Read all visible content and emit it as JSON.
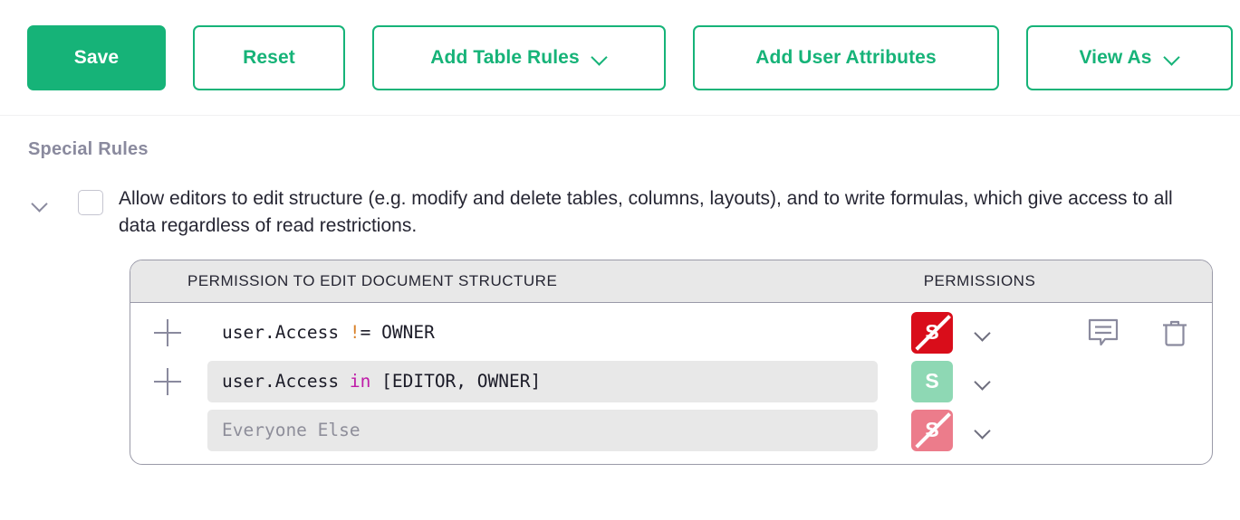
{
  "toolbar": {
    "buttons": [
      {
        "label": "Save",
        "style": "primary",
        "icon": null,
        "name": "save-button"
      },
      {
        "label": "Reset",
        "style": "outline",
        "icon": null,
        "name": "reset-button"
      },
      {
        "label": "Add Table Rules",
        "style": "outline",
        "icon": "chevron-down-icon",
        "name": "add-table-rules-button"
      },
      {
        "label": "Add User Attributes",
        "style": "outline",
        "icon": null,
        "name": "add-user-attributes-button"
      },
      {
        "label": "View As",
        "style": "outline",
        "icon": "chevron-down-icon",
        "name": "view-as-button"
      }
    ]
  },
  "section": {
    "title": "Special Rules"
  },
  "special_rule": {
    "collapse_icon": "chevron-down-icon",
    "checkbox_checked": false,
    "description": "Allow editors to edit structure (e.g. modify and delete tables, columns, layouts), and to write formulas, which give access to all data regardless of read restrictions."
  },
  "permission_table": {
    "headers": {
      "formula": "PERMISSION TO EDIT DOCUMENT STRUCTURE",
      "permissions": "PERMISSIONS"
    },
    "rows": [
      {
        "has_add": true,
        "formula_style": "plain",
        "tokens": [
          {
            "text": "user.Access ",
            "type": "txt"
          },
          {
            "text": "!",
            "type": "op"
          },
          {
            "text": "= OWNER",
            "type": "txt"
          }
        ],
        "badge": {
          "glyph": "S",
          "color": "#d90d1a",
          "struck": true,
          "name": "permission-deny-badge"
        },
        "dropdown_icon": "chevron-down-icon",
        "actions": [
          "comment-icon",
          "trash-icon"
        ]
      },
      {
        "has_add": true,
        "formula_style": "filled",
        "tokens": [
          {
            "text": "user.Access ",
            "type": "txt"
          },
          {
            "text": "in",
            "type": "kw"
          },
          {
            "text": " [EDITOR, OWNER]",
            "type": "txt"
          }
        ],
        "badge": {
          "glyph": "S",
          "color": "#8ed8b4",
          "struck": false,
          "name": "permission-allow-badge"
        },
        "dropdown_icon": "chevron-down-icon",
        "actions": []
      },
      {
        "has_add": false,
        "formula_style": "ph",
        "placeholder": "Everyone Else",
        "tokens": [],
        "badge": {
          "glyph": "S",
          "color": "#ec7c8b",
          "struck": true,
          "name": "permission-deny-default-badge"
        },
        "dropdown_icon": "chevron-down-icon",
        "actions": []
      }
    ]
  },
  "colors": {
    "brand_green": "#16b378",
    "deny_red": "#d90d1a",
    "allow_green": "#8ed8b4",
    "deny_pink": "#ec7c8b",
    "operator_orange": "#d9822b",
    "keyword_magenta": "#bf1ba8",
    "muted_text": "#8a8a9e"
  }
}
